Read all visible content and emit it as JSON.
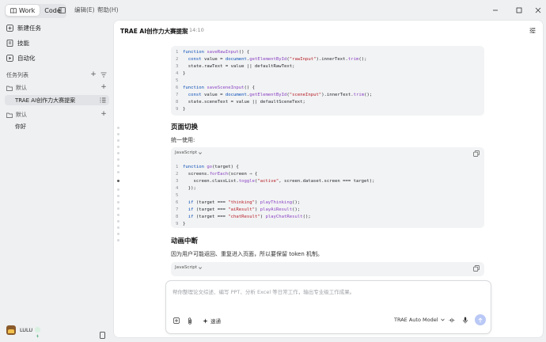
{
  "titlebar": {
    "mode_work": "Work",
    "mode_code": "Code",
    "menu_edit": "编辑(E)",
    "menu_help": "帮助(H)"
  },
  "sidebar": {
    "items": [
      {
        "label": "新建任务",
        "icon": "new-task-icon"
      },
      {
        "label": "技能",
        "icon": "skills-icon"
      },
      {
        "label": "自动化",
        "icon": "automation-icon"
      }
    ],
    "task_list_label": "任务列表",
    "groups": [
      {
        "label": "默认",
        "tasks": [
          "TRAE AI创作力大赛提案"
        ]
      },
      {
        "label": "默认",
        "tasks": [
          "你好"
        ]
      }
    ],
    "user_name": "LULU"
  },
  "main": {
    "title": "TRAE AI创作力大赛提案",
    "sync_time": "14:10",
    "code_block_1": [
      {
        "n": "1",
        "parts": [
          [
            "kw",
            "function "
          ],
          [
            "fn",
            "saveRawInput"
          ],
          [
            "blk",
            "() {"
          ]
        ]
      },
      {
        "n": "2",
        "parts": [
          [
            "kw",
            "  const "
          ],
          [
            "blk",
            "value = "
          ],
          [
            "kw",
            "document"
          ],
          [
            "blk",
            "."
          ],
          [
            "fn",
            "getElementById"
          ],
          [
            "blk",
            "("
          ],
          [
            "str",
            "\"rawInput\""
          ],
          [
            "blk",
            ").innerText."
          ],
          [
            "fn",
            "trim"
          ],
          [
            "blk",
            "();"
          ]
        ]
      },
      {
        "n": "3",
        "parts": [
          [
            "blk",
            "  state.rawText = value || defaultRawText;"
          ]
        ]
      },
      {
        "n": "4",
        "parts": [
          [
            "blk",
            "}"
          ]
        ]
      },
      {
        "n": "5",
        "parts": [
          [
            "blk",
            ""
          ]
        ]
      },
      {
        "n": "6",
        "parts": [
          [
            "kw",
            "function "
          ],
          [
            "fn",
            "saveSceneInput"
          ],
          [
            "blk",
            "() {"
          ]
        ]
      },
      {
        "n": "7",
        "parts": [
          [
            "kw",
            "  const "
          ],
          [
            "blk",
            "value = "
          ],
          [
            "kw",
            "document"
          ],
          [
            "blk",
            "."
          ],
          [
            "fn",
            "getElementById"
          ],
          [
            "blk",
            "("
          ],
          [
            "str",
            "\"sceneInput\""
          ],
          [
            "blk",
            ").innerText."
          ],
          [
            "fn",
            "trim"
          ],
          [
            "blk",
            "();"
          ]
        ]
      },
      {
        "n": "8",
        "parts": [
          [
            "blk",
            "  state.sceneText = value || defaultSceneText;"
          ]
        ]
      },
      {
        "n": "9",
        "parts": [
          [
            "blk",
            "}"
          ]
        ]
      }
    ],
    "heading_1": "页面切换",
    "para_1": "统一使用:",
    "code_lang": "JavaScript",
    "code_block_2": [
      {
        "n": "1",
        "parts": [
          [
            "kw",
            "function "
          ],
          [
            "fn",
            "go"
          ],
          [
            "blk",
            "(target) {"
          ]
        ]
      },
      {
        "n": "2",
        "parts": [
          [
            "blk",
            "  screens."
          ],
          [
            "fn",
            "forEach"
          ],
          [
            "blk",
            "(screen ⇒ {"
          ]
        ]
      },
      {
        "n": "3",
        "parts": [
          [
            "blk",
            "    screen.classList."
          ],
          [
            "fn",
            "toggle"
          ],
          [
            "blk",
            "("
          ],
          [
            "str",
            "\"active\""
          ],
          [
            "blk",
            ", screen.dataset.screen === target);"
          ]
        ]
      },
      {
        "n": "4",
        "parts": [
          [
            "blk",
            "  });"
          ]
        ]
      },
      {
        "n": "5",
        "parts": [
          [
            "blk",
            ""
          ]
        ]
      },
      {
        "n": "6",
        "parts": [
          [
            "kw",
            "  if "
          ],
          [
            "blk",
            "(target === "
          ],
          [
            "str",
            "\"thinking\""
          ],
          [
            "blk",
            ") "
          ],
          [
            "fn",
            "playThinking"
          ],
          [
            "blk",
            "();"
          ]
        ]
      },
      {
        "n": "7",
        "parts": [
          [
            "kw",
            "  if "
          ],
          [
            "blk",
            "(target === "
          ],
          [
            "str",
            "\"aiResult\""
          ],
          [
            "blk",
            ") "
          ],
          [
            "fn",
            "playAiResult"
          ],
          [
            "blk",
            "();"
          ]
        ]
      },
      {
        "n": "8",
        "parts": [
          [
            "kw",
            "  if "
          ],
          [
            "blk",
            "(target === "
          ],
          [
            "str",
            "\"chatResult\""
          ],
          [
            "blk",
            ") "
          ],
          [
            "fn",
            "playChatResult"
          ],
          [
            "blk",
            "();"
          ]
        ]
      },
      {
        "n": "9",
        "parts": [
          [
            "blk",
            "}"
          ]
        ]
      }
    ],
    "heading_2": "动画中断",
    "para_2": "因为用户可能返回、重复进入页面，所以要保留 token 机制。",
    "code_lang_2": "JavaScript"
  },
  "input": {
    "placeholder": "帮你整理论文综述、编写 PPT、分析 Excel 等日常工作，输出专业级工作成果。",
    "speed_label": "速通",
    "model_label": "TRAE Auto Model"
  },
  "colors": {
    "accent": "#2f6fe4",
    "send": "#b9c8f5"
  }
}
